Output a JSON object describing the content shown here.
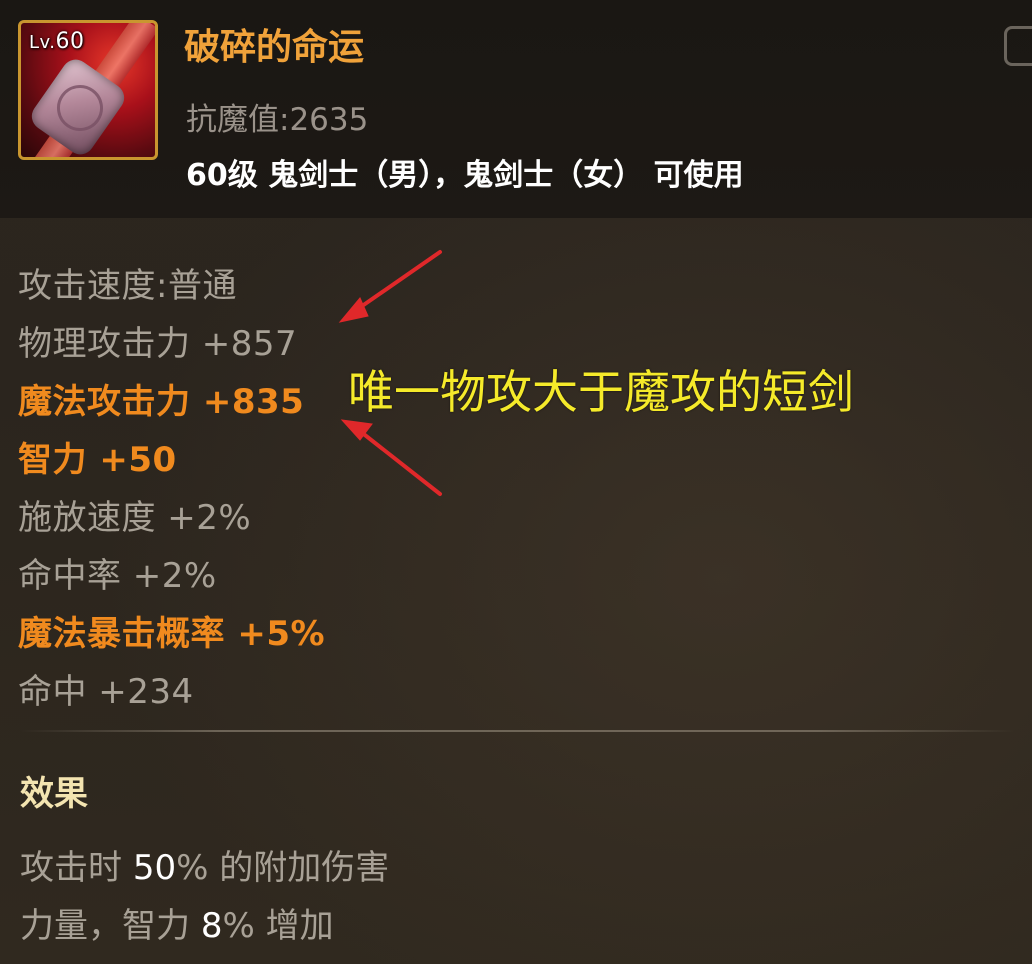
{
  "item": {
    "level_prefix": "Lv.",
    "level": "60",
    "name": "破碎的命运",
    "resist": "抗魔值:2635",
    "requirement": "60级 鬼剑士（男），鬼剑士（女） 可使用"
  },
  "stats": [
    {
      "text": "攻击速度:普通",
      "style": "grey"
    },
    {
      "text": "物理攻击力 +857",
      "style": "grey"
    },
    {
      "text": "魔法攻击力 +835",
      "style": "orange"
    },
    {
      "text": "智力 +50",
      "style": "orange"
    },
    {
      "text": "施放速度 +2%",
      "style": "grey"
    },
    {
      "text": "命中率 +2%",
      "style": "grey"
    },
    {
      "text": "魔法暴击概率 +5%",
      "style": "orange"
    },
    {
      "text": "命中 +234",
      "style": "grey"
    }
  ],
  "annotation": "唯一物攻大于魔攻的短剑",
  "effect": {
    "title": "效果",
    "line1_pre": "攻击时 ",
    "line1_val": "50",
    "line1_post": "% 的附加伤害",
    "line2_pre": "力量，智力 ",
    "line2_val": "8",
    "line2_post": "% 增加"
  },
  "colors": {
    "name": "#f0a23a",
    "highlight_stat": "#f08a1e",
    "normal_stat": "#a8a196",
    "annotation": "#f5ea2a",
    "arrow": "#e0282a",
    "icon_border": "#c9962f"
  },
  "icons": {
    "item_icon": "short-sword-icon",
    "corner": "collapse-icon"
  }
}
